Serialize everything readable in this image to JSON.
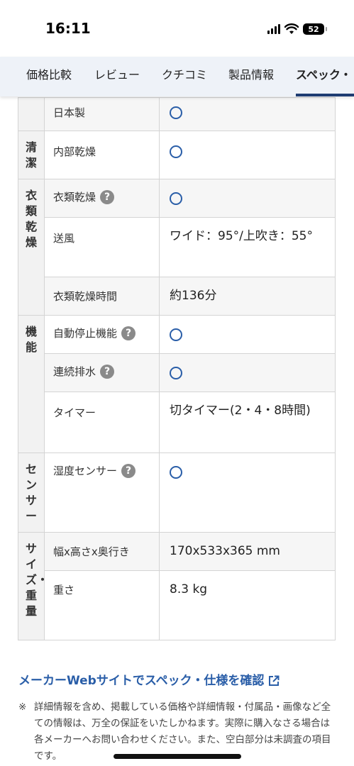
{
  "status": {
    "time": "16:11",
    "battery": "52"
  },
  "tabs": [
    {
      "label": "価格比較"
    },
    {
      "label": "レビュー"
    },
    {
      "label": "クチコミ"
    },
    {
      "label": "製品情報"
    },
    {
      "label": "スペック・"
    }
  ],
  "specs": {
    "r0": {
      "label": "日本製"
    },
    "clean": {
      "category": "清潔",
      "r1": {
        "label": "内部乾燥"
      }
    },
    "dry": {
      "category": "衣類乾燥",
      "r1": {
        "label": "衣類乾燥"
      },
      "r2": {
        "label": "送風",
        "value": "ワイド：95°/上吹き：55°"
      },
      "r3": {
        "label": "衣類乾燥時間",
        "value": "約136分"
      }
    },
    "func": {
      "category": "機能",
      "r1": {
        "label": "自動停止機能"
      },
      "r2": {
        "label": "連続排水"
      },
      "r3": {
        "label": "タイマー",
        "value": "切タイマー(2・4・8時間)"
      }
    },
    "sensor": {
      "category": "センサー",
      "r1": {
        "label": "湿度センサー"
      }
    },
    "size": {
      "category": "サイズ・重量",
      "r1": {
        "label": "幅x高さx奥行き",
        "value": "170x533x365 mm"
      },
      "r2": {
        "label": "重さ",
        "value": "8.3 kg"
      }
    }
  },
  "maker_link": {
    "label": "メーカーWebサイトでスペック・仕様を確認"
  },
  "notice": {
    "mark": "※",
    "text": "詳細情報を含め、掲載している価格や詳細情報・付属品・画像など全ての情報は、万全の保証をいたしかねます。実際に購入なさる場合は各メーカーへお問い合わせください。また、空白部分は未調査の項目です。"
  },
  "colors": {
    "accent": "#2a5ea8",
    "tab_underline": "#1e3c72"
  }
}
